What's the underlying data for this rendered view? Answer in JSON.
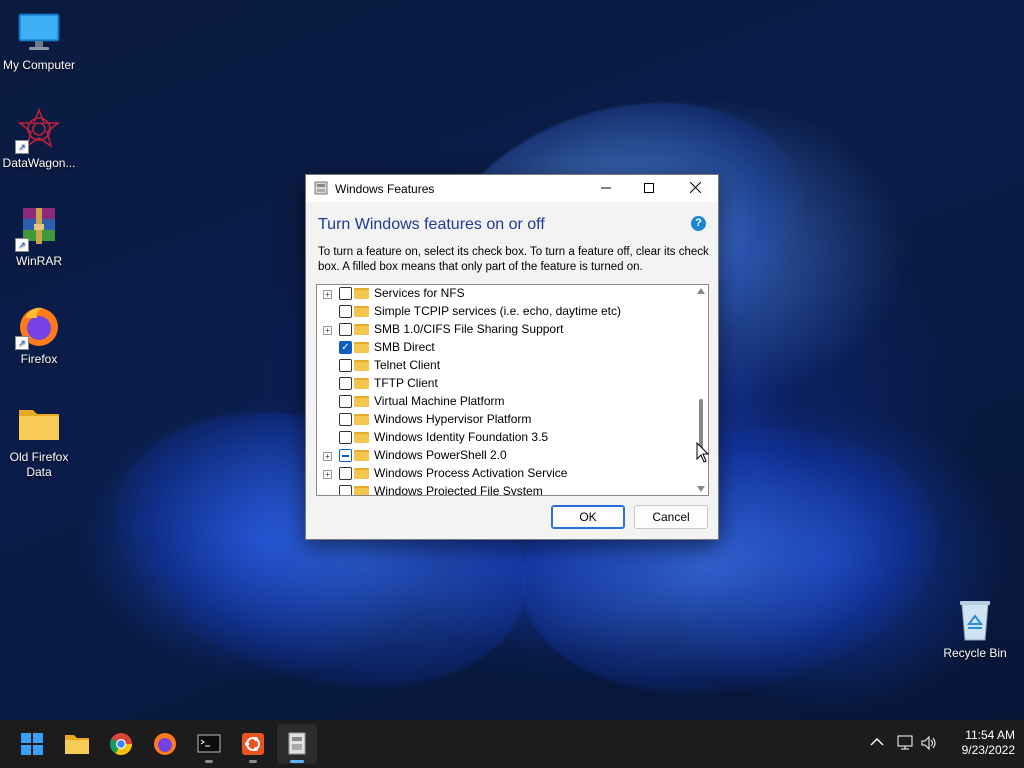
{
  "desktop": {
    "icons": [
      {
        "label": "My Computer"
      },
      {
        "label": "DataWagon..."
      },
      {
        "label": "WinRAR"
      },
      {
        "label": "Firefox"
      },
      {
        "label": "Old Firefox Data"
      },
      {
        "label": "Recycle Bin"
      }
    ]
  },
  "dialog": {
    "title": "Windows Features",
    "heading": "Turn Windows features on or off",
    "help": "?",
    "description": "To turn a feature on, select its check box. To turn a feature off, clear its check box. A filled box means that only part of the feature is turned on.",
    "features": [
      {
        "label": "Services for NFS",
        "expandable": true,
        "state": "unchecked"
      },
      {
        "label": "Simple TCPIP services (i.e. echo, daytime etc)",
        "expandable": false,
        "state": "unchecked"
      },
      {
        "label": "SMB 1.0/CIFS File Sharing Support",
        "expandable": true,
        "state": "unchecked"
      },
      {
        "label": "SMB Direct",
        "expandable": false,
        "state": "checked"
      },
      {
        "label": "Telnet Client",
        "expandable": false,
        "state": "unchecked"
      },
      {
        "label": "TFTP Client",
        "expandable": false,
        "state": "unchecked"
      },
      {
        "label": "Virtual Machine Platform",
        "expandable": false,
        "state": "unchecked"
      },
      {
        "label": "Windows Hypervisor Platform",
        "expandable": false,
        "state": "unchecked"
      },
      {
        "label": "Windows Identity Foundation 3.5",
        "expandable": false,
        "state": "unchecked"
      },
      {
        "label": "Windows PowerShell 2.0",
        "expandable": true,
        "state": "partial"
      },
      {
        "label": "Windows Process Activation Service",
        "expandable": true,
        "state": "unchecked"
      },
      {
        "label": "Windows Projected File System",
        "expandable": false,
        "state": "unchecked"
      }
    ],
    "ok_label": "OK",
    "cancel_label": "Cancel"
  },
  "taskbar": {
    "apps": [
      {
        "icon": "windows-start-icon"
      },
      {
        "icon": "file-explorer-icon"
      },
      {
        "icon": "chrome-icon"
      },
      {
        "icon": "firefox-icon"
      },
      {
        "icon": "terminal-icon"
      },
      {
        "icon": "ubuntu-icon"
      },
      {
        "icon": "windows-features-icon"
      }
    ],
    "time": "11:54 AM",
    "date": "9/23/2022"
  }
}
